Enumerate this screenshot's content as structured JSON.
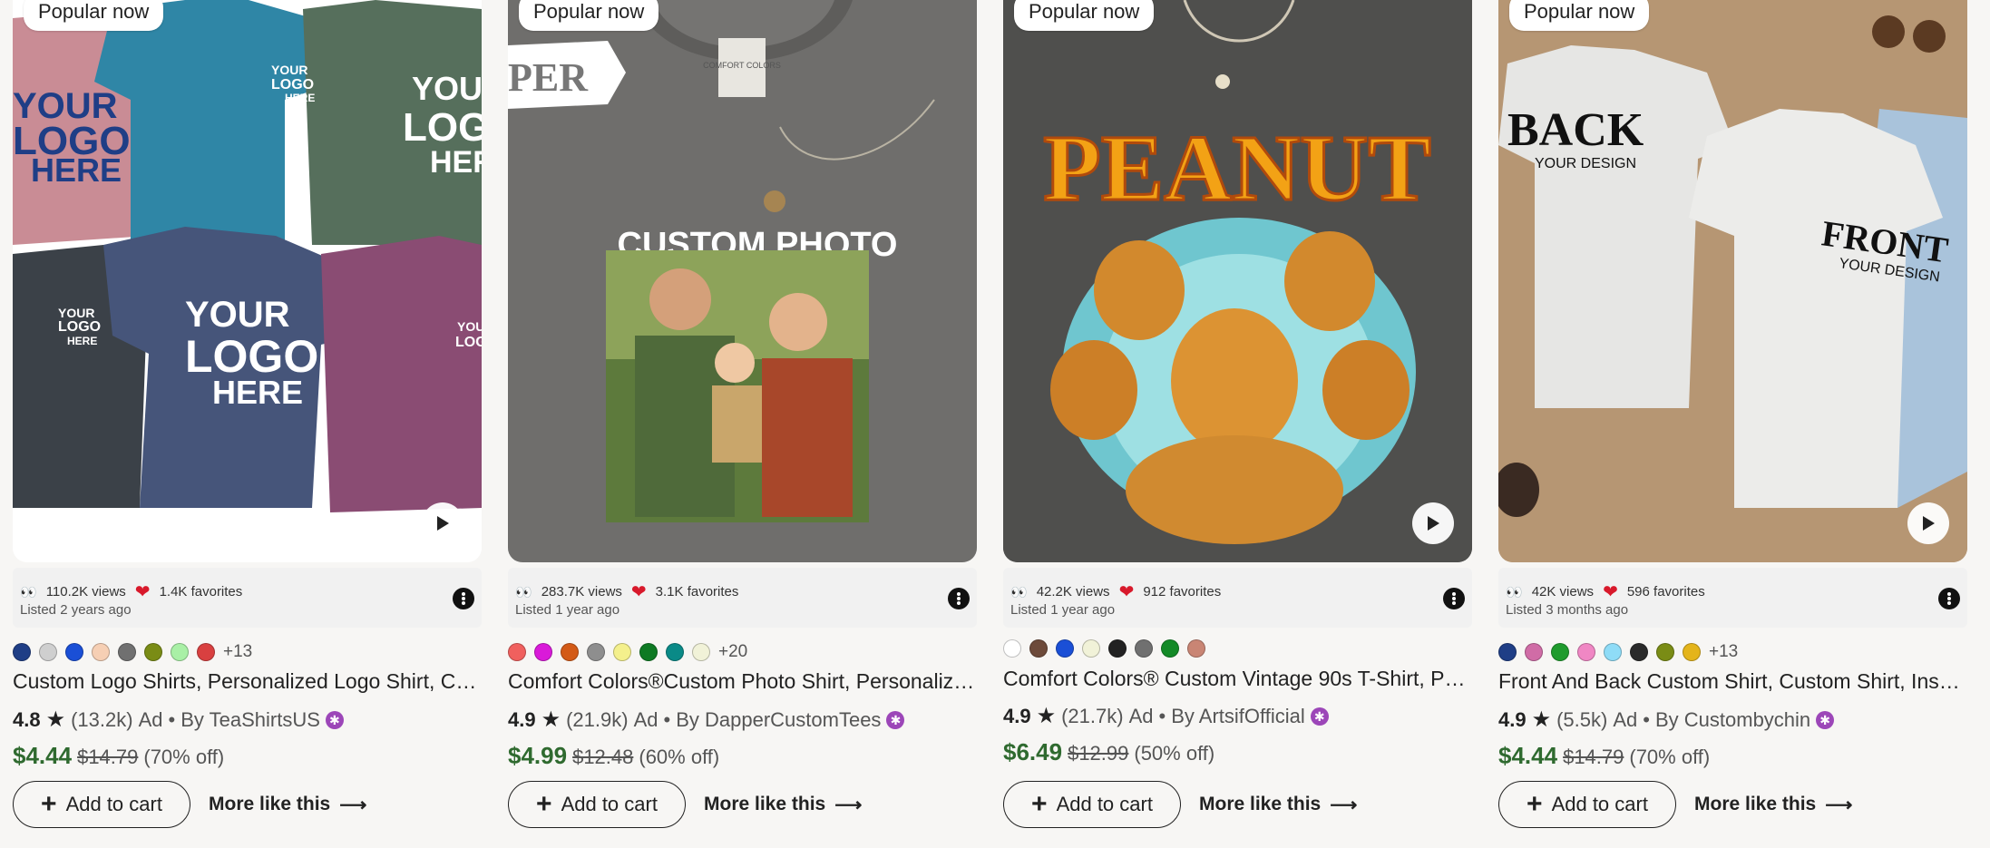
{
  "cards": [
    {
      "badge": "Popular now",
      "views": "110.2K views",
      "favorites": "1.4K favorites",
      "listed": "Listed 2 years ago",
      "swatches": [
        "#1f3e86",
        "#cfcfcf",
        "#1a4fd6",
        "#f6cfb4",
        "#707070",
        "#7a8c15",
        "#a9f0a6",
        "#d94040"
      ],
      "more_colors": "+13",
      "title": "Custom Logo Shirts, Personalized Logo Shirt, Cu...",
      "rating": "4.8",
      "reviews": "(13.2k)",
      "ad": "Ad",
      "by": "By TeaShirtsUS",
      "price_now": "$4.44",
      "price_old": "$14.79",
      "discount": "(70% off)",
      "add_to_cart": "Add to cart",
      "more_like": "More like this"
    },
    {
      "badge": "Popular now",
      "views": "283.7K views",
      "favorites": "3.1K favorites",
      "listed": "Listed 1 year ago",
      "swatches": [
        "#f0605e",
        "#d91ad9",
        "#d35a16",
        "#8e8e8e",
        "#f4f08c",
        "#0e7a23",
        "#0a8a87",
        "#f1f2d8"
      ],
      "more_colors": "+20",
      "title": "Comfort Colors®Custom Photo Shirt, Personalize...",
      "rating": "4.9",
      "reviews": "(21.9k)",
      "ad": "Ad",
      "by": "By DapperCustomTees",
      "price_now": "$4.99",
      "price_old": "$12.48",
      "discount": "(60% off)",
      "add_to_cart": "Add to cart",
      "more_like": "More like this"
    },
    {
      "badge": "Popular now",
      "views": "42.2K views",
      "favorites": "912 favorites",
      "listed": "Listed 1 year ago",
      "swatches": [
        "#ffffff",
        "#6d4a3a",
        "#1a4fd6",
        "#f1f2d8",
        "#222222",
        "#707070",
        "#138a27",
        "#c98574"
      ],
      "more_colors": "",
      "title": "Comfort Colors® Custom Vintage 90s T-Shirt, Per...",
      "rating": "4.9",
      "reviews": "(21.7k)",
      "ad": "Ad",
      "by": "By ArtsifOfficial",
      "price_now": "$6.49",
      "price_old": "$12.99",
      "discount": "(50% off)",
      "add_to_cart": "Add to cart",
      "more_like": "More like this"
    },
    {
      "badge": "Popular now",
      "views": "42K views",
      "favorites": "596 favorites",
      "listed": "Listed 3 months ago",
      "swatches": [
        "#1f3e86",
        "#d06ca6",
        "#1f9b2d",
        "#f087c4",
        "#8fdcf7",
        "#2a2a2a",
        "#7a8c15",
        "#e4b41a"
      ],
      "more_colors": "+13",
      "title": "Front And Back Custom Shirt, Custom Shirt, Inspi...",
      "rating": "4.9",
      "reviews": "(5.5k)",
      "ad": "Ad",
      "by": "By Custombychin",
      "price_now": "$4.44",
      "price_old": "$14.79",
      "discount": "(70% off)",
      "add_to_cart": "Add to cart",
      "more_like": "More like this"
    }
  ],
  "image_text": {
    "card1": {
      "line1": "YOUR",
      "line2": "LOGO",
      "line3": "HERE"
    },
    "card2": {
      "heading": "CUSTOM PHOTO",
      "tag": "PER",
      "label": "COMFORT COLORS"
    },
    "card3": {
      "heading": "PEANUT"
    },
    "card4": {
      "back": "BACK",
      "back_sub": "YOUR DESIGN",
      "front": "FRONT",
      "front_sub": "YOUR DESIGN"
    }
  },
  "icons": {
    "eyes": "eyes-icon",
    "heart": "heart-icon",
    "star": "star-icon",
    "play": "play-icon",
    "plus": "plus-icon",
    "arrow": "arrow-right-icon",
    "kebab": "more-options-icon",
    "star_seller": "star-seller-icon"
  },
  "colors": {
    "price_green": "#2f6a2f",
    "star_seller_purple": "#9c46b8"
  }
}
